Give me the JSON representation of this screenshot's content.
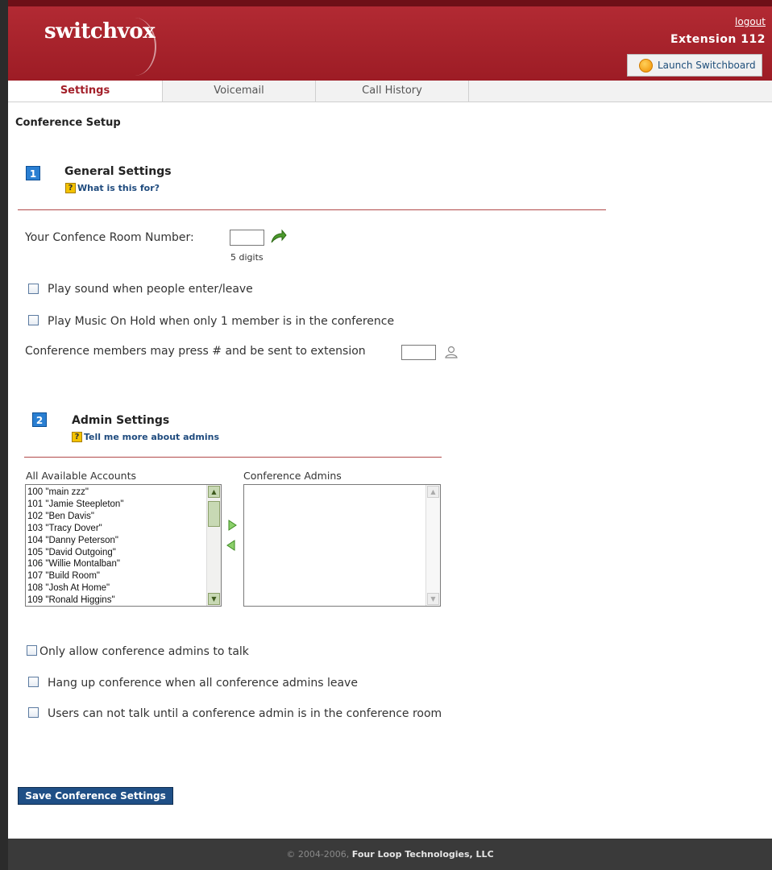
{
  "header": {
    "logo": "switchvox",
    "logout": "logout",
    "extension": "Extension 112",
    "launch_switchboard": "Launch Switchboard"
  },
  "tabs": [
    {
      "label": "Settings",
      "active": true
    },
    {
      "label": "Voicemail",
      "active": false
    },
    {
      "label": "Call History",
      "active": false
    }
  ],
  "page_title": "Conference Setup",
  "general": {
    "number": "1",
    "title": "General Settings",
    "help": "What is this for?",
    "room_number_label": "Your Confence Room Number:",
    "room_number_value": "",
    "digits_hint": "5 digits",
    "play_sound_label": "Play sound when people enter/leave",
    "play_moh_label": "Play Music On Hold when only 1 member is in the conference",
    "press_hash_label": "Conference members may press # and be sent to extension",
    "press_hash_value": ""
  },
  "admin": {
    "number": "2",
    "title": "Admin Settings",
    "help": "Tell me more about admins",
    "available_label": "All Available Accounts",
    "admins_label": "Conference Admins",
    "available_accounts": [
      "100 \"main zzz\"",
      "101 \"Jamie Steepleton\"",
      "102 \"Ben Davis\"",
      "103 \"Tracy Dover\"",
      "104 \"Danny Peterson\"",
      "105 \"David Outgoing\"",
      "106 \"Willie Montalban\"",
      "107 \"Build Room\"",
      "108 \"Josh At Home\"",
      "109 \"Ronald Higgins\""
    ],
    "conference_admins": [],
    "only_admins_talk": "Only allow conference admins to talk",
    "hang_up": "Hang up conference when all conference admins leave",
    "cannot_talk": "Users can not talk until a conference admin is in the conference room"
  },
  "save_button": "Save Conference Settings",
  "footer": {
    "copyright": "© 2004-2006,",
    "company": "Four Loop Technologies, LLC"
  },
  "colors": {
    "brand": "#a3202a",
    "link": "#1f4b7e",
    "button": "#1f4f86"
  }
}
